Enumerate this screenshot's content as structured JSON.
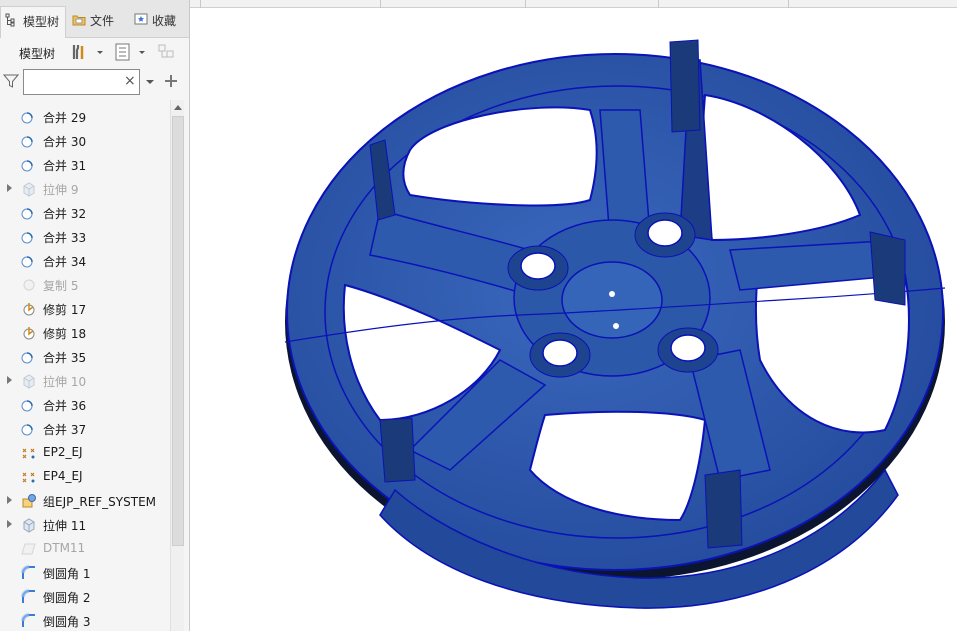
{
  "tabs": [
    {
      "label": "模型树",
      "icon": "tree-icon"
    },
    {
      "label": "文件",
      "icon": "folder-icon"
    },
    {
      "label": "收藏",
      "icon": "favorites-icon"
    }
  ],
  "toolbar": {
    "label": "模型树"
  },
  "search": {
    "value": "",
    "placeholder": ""
  },
  "tree": {
    "items": [
      {
        "label": "合并 29",
        "icon": "merge-icon",
        "suppressed": false,
        "expandable": false
      },
      {
        "label": "合并 30",
        "icon": "merge-icon",
        "suppressed": false,
        "expandable": false
      },
      {
        "label": "合并 31",
        "icon": "merge-icon",
        "suppressed": false,
        "expandable": false
      },
      {
        "label": "拉伸 9",
        "icon": "extrude-icon",
        "suppressed": true,
        "expandable": true
      },
      {
        "label": "合并 32",
        "icon": "merge-icon",
        "suppressed": false,
        "expandable": false
      },
      {
        "label": "合并 33",
        "icon": "merge-icon",
        "suppressed": false,
        "expandable": false
      },
      {
        "label": "合并 34",
        "icon": "merge-icon",
        "suppressed": false,
        "expandable": false
      },
      {
        "label": "复制 5",
        "icon": "copy-icon",
        "suppressed": true,
        "expandable": false
      },
      {
        "label": "修剪 17",
        "icon": "trim-icon",
        "suppressed": false,
        "expandable": false
      },
      {
        "label": "修剪 18",
        "icon": "trim-icon",
        "suppressed": false,
        "expandable": false
      },
      {
        "label": "合并 35",
        "icon": "merge-icon",
        "suppressed": false,
        "expandable": false
      },
      {
        "label": "拉伸 10",
        "icon": "extrude-icon",
        "suppressed": true,
        "expandable": true
      },
      {
        "label": "合并 36",
        "icon": "merge-icon",
        "suppressed": false,
        "expandable": false
      },
      {
        "label": "合并 37",
        "icon": "merge-icon",
        "suppressed": false,
        "expandable": false
      },
      {
        "label": "EP2_EJ",
        "icon": "datum-point-icon",
        "suppressed": false,
        "expandable": false
      },
      {
        "label": "EP4_EJ",
        "icon": "datum-point-icon",
        "suppressed": false,
        "expandable": false
      },
      {
        "label": "组EJP_REF_SYSTEM",
        "icon": "group-icon",
        "suppressed": false,
        "expandable": true
      },
      {
        "label": "拉伸 11",
        "icon": "extrude-icon",
        "suppressed": false,
        "expandable": true
      },
      {
        "label": "DTM11",
        "icon": "datum-plane-icon",
        "suppressed": true,
        "expandable": false
      },
      {
        "label": "倒圆角 1",
        "icon": "round-icon",
        "suppressed": false,
        "expandable": false
      },
      {
        "label": "倒圆角 2",
        "icon": "round-icon",
        "suppressed": false,
        "expandable": false
      },
      {
        "label": "倒圆角 3",
        "icon": "round-icon",
        "suppressed": false,
        "expandable": false
      }
    ]
  },
  "colors": {
    "model": "#2a55a6",
    "model_dark": "#1a3a7a",
    "edge": "#0a12b8",
    "shadow": "#0c1530"
  }
}
